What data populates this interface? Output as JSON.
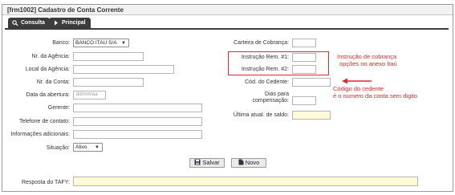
{
  "window": {
    "title": "[frm1002] Cadastro de Conta Corrente"
  },
  "tabs": [
    {
      "label": "Consulta"
    },
    {
      "label": "Principal"
    }
  ],
  "left_form": {
    "banco_label": "Banco:",
    "banco_value": "BANCO ITAU S/A",
    "agencia_label": "Nr. da Agência:",
    "local_agencia_label": "Local da Agência:",
    "conta_label": "Nr. da Conta:",
    "abertura_label": "Data da abertura:",
    "abertura_placeholder": "dd/mm/aa",
    "gerente_label": "Gerente:",
    "telefone_label": "Telefone de contato:",
    "info_label": "Informações adicionais:",
    "situacao_label": "Situação:",
    "situacao_value": "Ativo"
  },
  "right_form": {
    "carteira_label": "Carteira de Cobrança:",
    "instrucao1_label": "Instrução Rem. #1:",
    "instrucao2_label": "Instrução Rem. #2:",
    "cedente_label": "Cód. do Cedente:",
    "dias_label_1": "Dias para",
    "dias_label_2": "compensação:",
    "ultima_label": "Última atual. de saldo:"
  },
  "annotations": {
    "instrucao_note_1": "Instrução de cobrança",
    "instrucao_note_2": "opções no anexo Itaú",
    "cedente_note_1": "Código do cedente",
    "cedente_note_2": "é o numero da conta sem digito",
    "color": "#e8262b"
  },
  "buttons": {
    "save": "Salvar",
    "new": "Novo"
  },
  "tafy": {
    "label": "Resposta do TAFY:"
  },
  "colors": {
    "tab_bg": "#3c3c3c",
    "readonly_bg": "#fffbd6"
  }
}
